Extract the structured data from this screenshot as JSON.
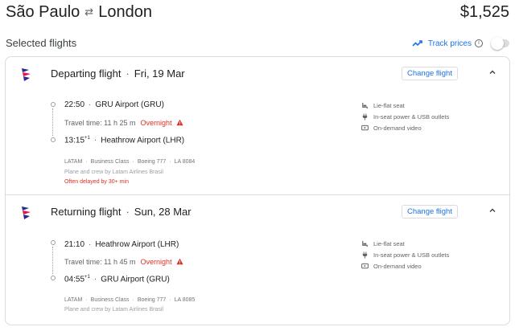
{
  "header": {
    "origin": "São Paulo",
    "arrow": "⇄",
    "destination": "London",
    "price": "$1,525"
  },
  "selected": {
    "title": "Selected flights",
    "track_label": "Track prices",
    "track_enabled": false
  },
  "flights": [
    {
      "title_direction": "Departing flight",
      "title_date": "Fri, 19 Mar",
      "change_label": "Change flight",
      "dep_time": "22:50",
      "dep_airport": "GRU Airport (GRU)",
      "travel_time": "Travel time: 11 h 25 m",
      "overnight": "Overnight",
      "arr_time": "13:15",
      "arr_dayplus": "+1",
      "arr_airport": "Heathrow Airport (LHR)",
      "airline": "LATAM",
      "cabin": "Business Class",
      "aircraft": "Boeing 777",
      "flight_no": "LA 8084",
      "operated": "Plane and crew by Latam Airlines Brasil",
      "delay_note": "Often delayed by 30+ min",
      "amenities": [
        "Lie-flat seat",
        "In-seat power & USB outlets",
        "On-demand video"
      ]
    },
    {
      "title_direction": "Returning flight",
      "title_date": "Sun, 28 Mar",
      "change_label": "Change flight",
      "dep_time": "21:10",
      "dep_airport": "Heathrow Airport (LHR)",
      "travel_time": "Travel time: 11 h 45 m",
      "overnight": "Overnight",
      "arr_time": "04:55",
      "arr_dayplus": "+1",
      "arr_airport": "GRU Airport (GRU)",
      "airline": "LATAM",
      "cabin": "Business Class",
      "aircraft": "Boeing 777",
      "flight_no": "LA 8085",
      "operated": "Plane and crew by Latam Airlines Brasil",
      "amenities": [
        "Lie-flat seat",
        "In-seat power & USB outlets",
        "On-demand video"
      ]
    }
  ],
  "icons": {
    "swap": "swap-arrows-icon",
    "trend": "trending-icon",
    "info": "info-icon",
    "chevron": "chevron-up-icon",
    "warning": "warning-icon",
    "seat": "seat-icon",
    "power": "power-plug-icon",
    "video": "video-icon",
    "logo": "latam-logo"
  },
  "colors": {
    "accent": "#1a73e8",
    "warning": "#d93025",
    "latam_indigo": "#2b2a8c",
    "latam_coral": "#e8114b"
  }
}
